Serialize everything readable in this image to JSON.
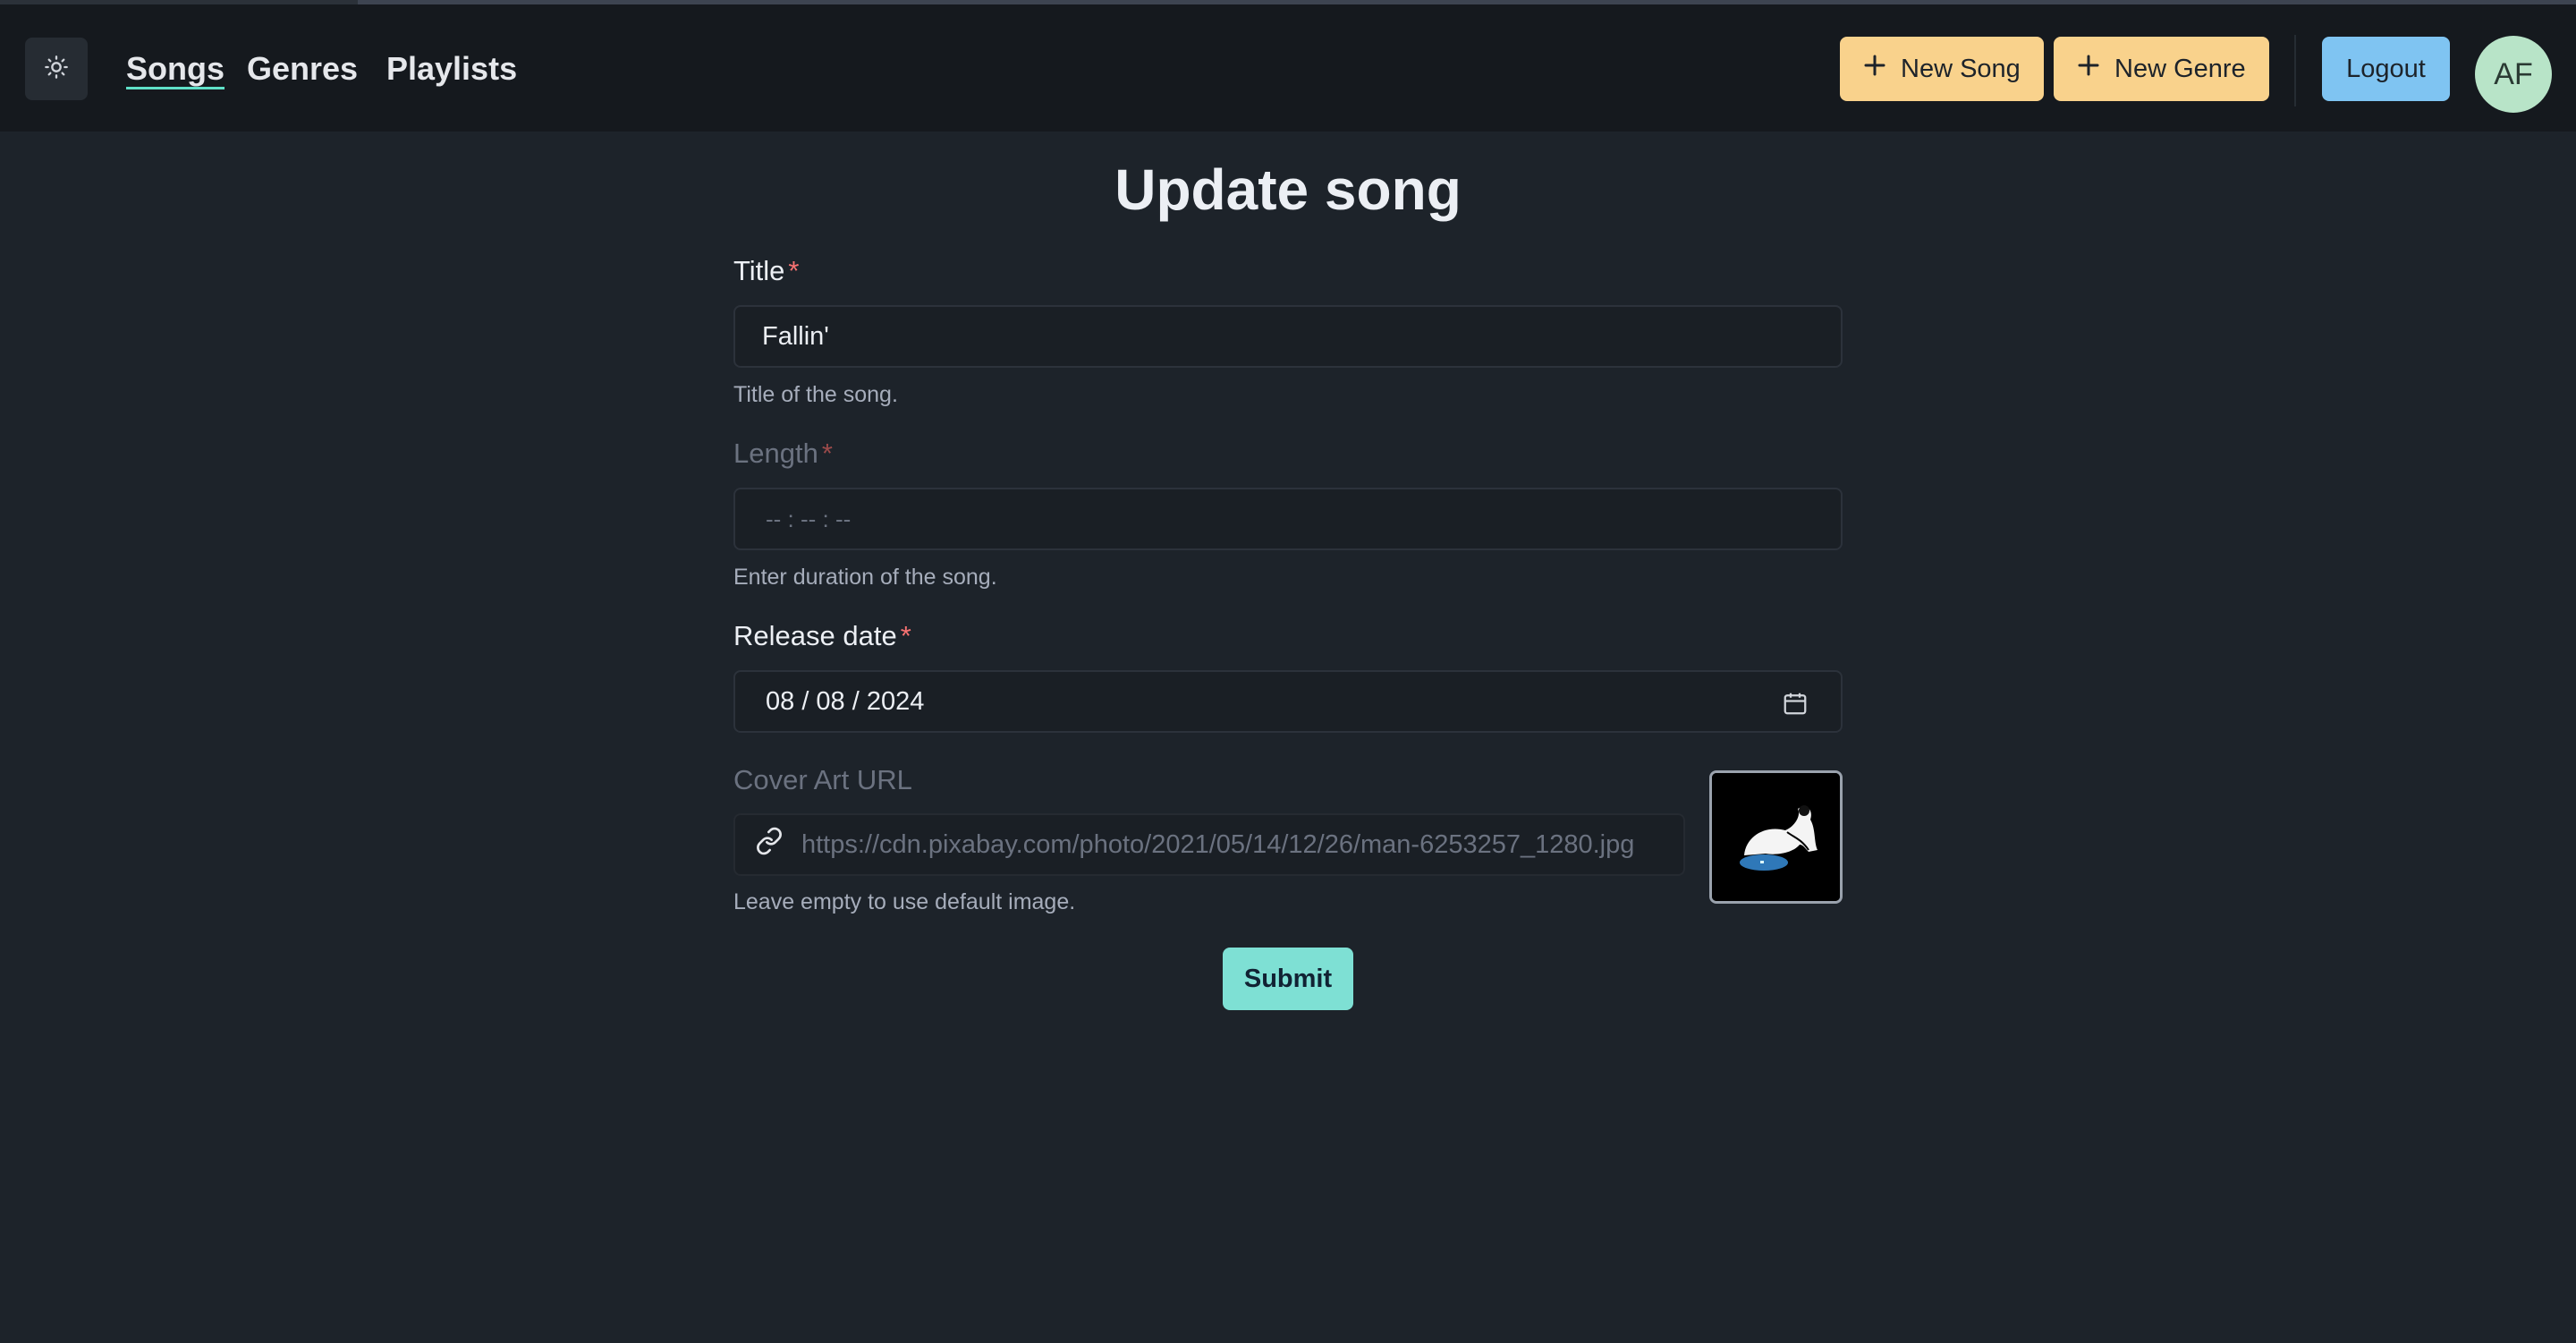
{
  "nav": {
    "links": [
      "Songs",
      "Genres",
      "Playlists"
    ],
    "new_song_label": "New Song",
    "new_genre_label": "New Genre",
    "logout_label": "Logout",
    "avatar_initials": "AF"
  },
  "form": {
    "heading": "Update song",
    "title": {
      "label": "Title",
      "required": "*",
      "value": "Fallin'",
      "hint": "Title of the song."
    },
    "length": {
      "label": "Length",
      "required": "*",
      "placeholder": "-- : -- : --",
      "hint": "Enter duration of the song."
    },
    "release_date": {
      "label": "Release date",
      "required": "*",
      "value": "08 / 08 / 2024"
    },
    "cover_art": {
      "label": "Cover Art URL",
      "value": "https://cdn.pixabay.com/photo/2021/05/14/12/26/man-6253257_1280.jpg",
      "hint": "Leave empty to use default image."
    },
    "submit_label": "Submit"
  },
  "colors": {
    "background": "#1d232a",
    "navbar": "#15191e",
    "warning": "#f9d28c",
    "info": "#7fc4f2",
    "accent": "#7ee0d4",
    "required": "#f87272"
  },
  "icons": [
    "sun-icon",
    "plus-icon",
    "calendar-icon",
    "link-icon"
  ]
}
